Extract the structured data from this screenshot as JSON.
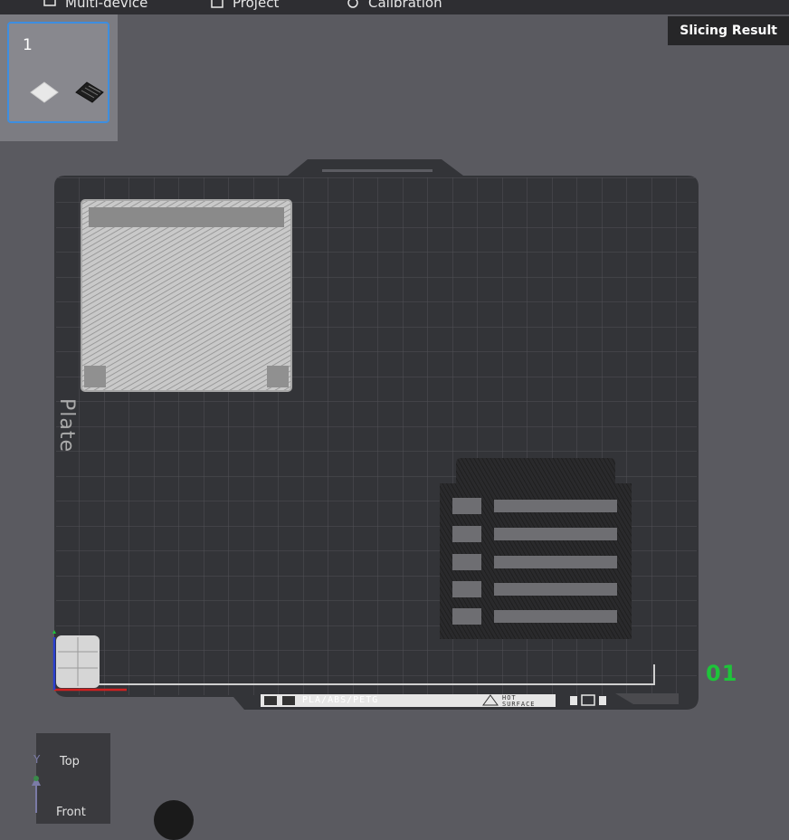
{
  "topbar": {
    "tabs": [
      {
        "label": "Multi-device",
        "icon": "multi-device-icon"
      },
      {
        "label": "Project",
        "icon": "project-icon"
      },
      {
        "label": "Calibration",
        "icon": "calibration-icon"
      }
    ]
  },
  "slicing_result_label": "Slicing Result",
  "plate_list": {
    "selected_plate": "1"
  },
  "bed": {
    "material_label": "PLA/ABS/PETG",
    "warning_label": "HOT SURFACE",
    "plate_label": "Plate",
    "plate_number": "01"
  },
  "viewcube": {
    "top": "Top",
    "front": "Front"
  },
  "colors": {
    "accent": "#3d8ee0",
    "plate_number": "#1ec43a",
    "bed": "#333438",
    "grid": "#505156"
  }
}
